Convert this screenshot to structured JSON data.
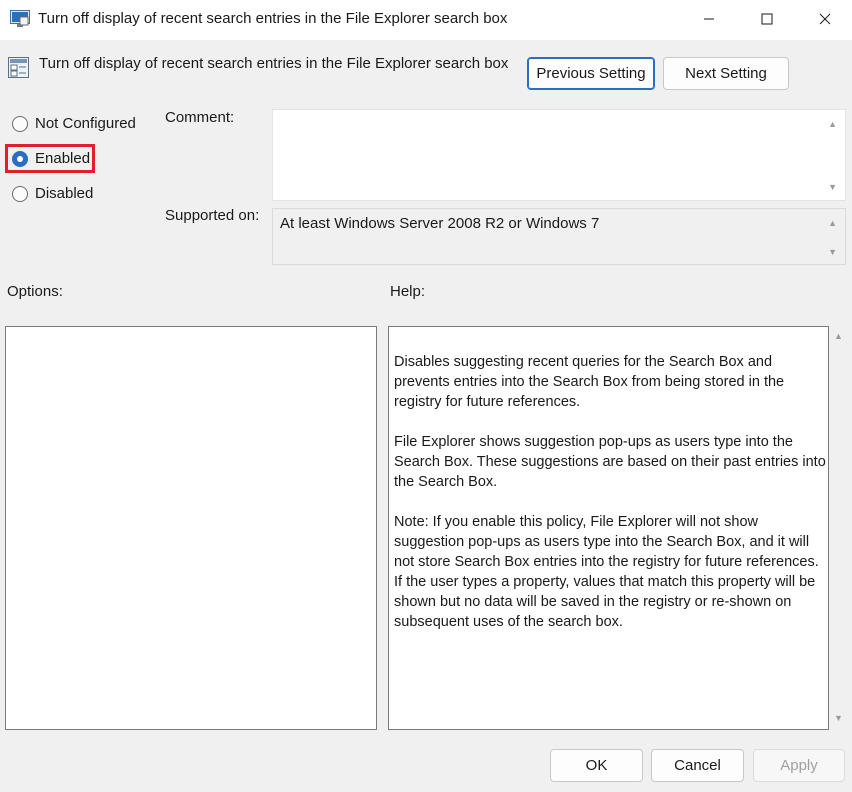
{
  "window": {
    "title": "Turn off display of recent search entries in the File Explorer search box"
  },
  "header": {
    "policy_title": "Turn off display of recent search entries in the File Explorer search box",
    "previous_label": "Previous Setting",
    "next_label": "Next Setting"
  },
  "state": {
    "options": [
      {
        "label": "Not Configured",
        "checked": false
      },
      {
        "label": "Enabled",
        "checked": true
      },
      {
        "label": "Disabled",
        "checked": false
      }
    ]
  },
  "comment": {
    "label": "Comment:",
    "value": ""
  },
  "supported": {
    "label": "Supported on:",
    "value": "At least Windows Server 2008 R2 or Windows 7"
  },
  "options_panel": {
    "label": "Options:"
  },
  "help": {
    "label": "Help:",
    "paragraphs": [
      "Disables suggesting recent queries for the Search Box and prevents entries into the Search Box from being stored in the registry for future references.",
      "File Explorer shows suggestion pop-ups as users type into the Search Box.  These suggestions are based on their past entries into the Search Box.",
      "Note: If you enable this policy, File Explorer will not show suggestion pop-ups as users type into the Search Box, and it will not store Search Box entries into the registry for future references.  If the user types a property, values that match this property will be shown but no data will be saved in the registry or re-shown on subsequent uses of the search box."
    ]
  },
  "footer": {
    "ok_label": "OK",
    "cancel_label": "Cancel",
    "apply_label": "Apply"
  },
  "colors": {
    "accent": "#2b6dc2",
    "highlight_border": "#e01e2e"
  }
}
